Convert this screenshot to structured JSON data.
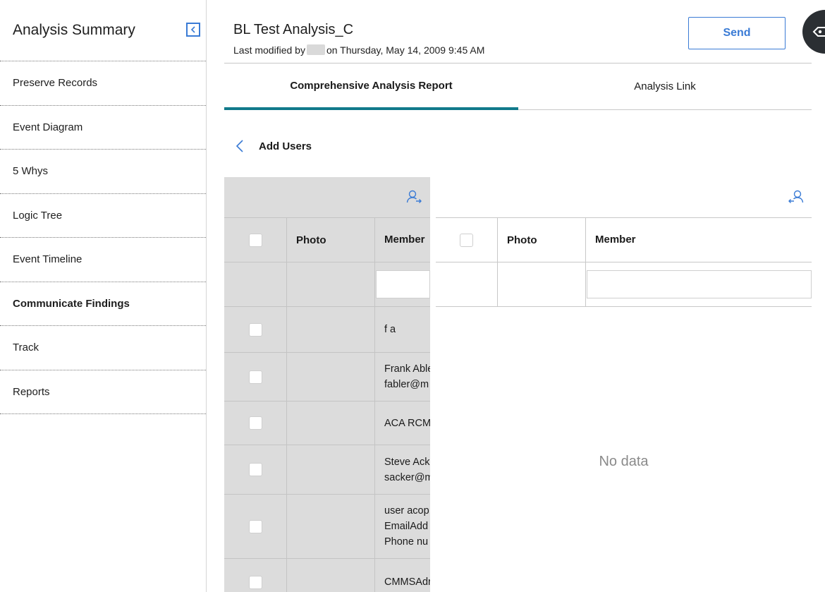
{
  "sidebar": {
    "title": "Analysis Summary",
    "items": [
      {
        "label": "Preserve Records"
      },
      {
        "label": "Event Diagram"
      },
      {
        "label": "5 Whys"
      },
      {
        "label": "Logic Tree"
      },
      {
        "label": "Event Timeline"
      },
      {
        "label": "Communicate Findings"
      },
      {
        "label": "Track"
      },
      {
        "label": "Reports"
      }
    ]
  },
  "header": {
    "title": "BL Test Analysis_C",
    "modified_prefix": "Last modified by",
    "modified_suffix": "on Thursday, May 14, 2009 9:45 AM",
    "send_label": "Send"
  },
  "tabs": [
    {
      "label": "Comprehensive Analysis Report"
    },
    {
      "label": "Analysis Link"
    }
  ],
  "add_users": {
    "label": "Add Users",
    "available": {
      "columns": [
        "Photo",
        "Member"
      ],
      "rows": [
        {
          "member": [
            "f a"
          ]
        },
        {
          "member": [
            "Frank Able",
            "fabler@m"
          ]
        },
        {
          "member": [
            "ACA RCM"
          ]
        },
        {
          "member": [
            "Steve Ack",
            "sacker@m"
          ]
        },
        {
          "member": [
            "user acop",
            "EmailAdd",
            "Phone nu"
          ]
        },
        {
          "member": [
            "CMMSAdr"
          ]
        }
      ]
    },
    "selected": {
      "columns": [
        "Photo",
        "Member"
      ],
      "empty_text": "No data"
    }
  },
  "colors": {
    "accent": "#3a7bd5",
    "tab_indicator": "#117a8b",
    "grid_bg": "#dcdcdc"
  }
}
